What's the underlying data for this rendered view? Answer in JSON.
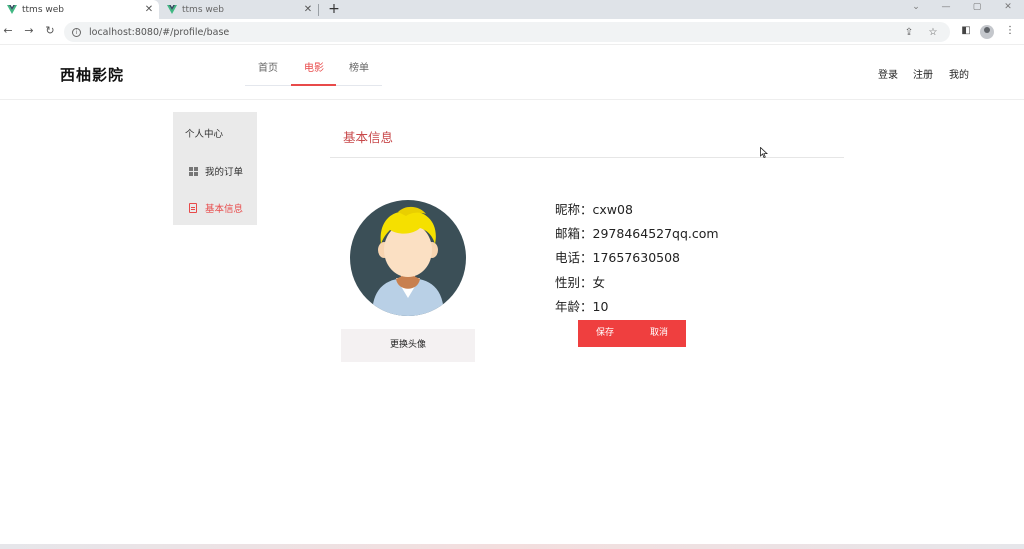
{
  "browser": {
    "tabs": [
      {
        "title": "ttms web",
        "active": true
      },
      {
        "title": "ttms web",
        "active": false
      }
    ],
    "url": "localhost:8080/#/profile/base",
    "icons": {
      "back": "back-arrow-icon",
      "forward": "forward-arrow-icon",
      "reload": "reload-icon",
      "share": "share-icon",
      "bookmark": "star-icon",
      "sidepanel": "side-panel-icon",
      "profile": "profile-icon",
      "menu": "kebab-menu-icon"
    }
  },
  "header": {
    "logo": "西柚影院",
    "nav": [
      "首页",
      "电影",
      "榜单"
    ],
    "active_nav": "电影",
    "auth": [
      "登录",
      "注册",
      "我的"
    ]
  },
  "sidebar": {
    "title": "个人中心",
    "items": [
      {
        "label": "我的订单",
        "icon": "grid-icon",
        "active": false
      },
      {
        "label": "基本信息",
        "icon": "document-icon",
        "active": true
      }
    ]
  },
  "profile": {
    "section_title": "基本信息",
    "change_avatar": "更换头像",
    "fields": [
      {
        "label": "昵称",
        "value": "cxw08"
      },
      {
        "label": "邮箱",
        "value": "2978464527qq.com"
      },
      {
        "label": "电话",
        "value": "17657630508"
      },
      {
        "label": "性别",
        "value": "女"
      },
      {
        "label": "年龄",
        "value": "10"
      }
    ],
    "separator": "：",
    "save": "保存",
    "cancel": "取消"
  },
  "colors": {
    "accent": "#e84a4a",
    "button": "#ef3f3f",
    "title": "#c8494b",
    "sidebar_bg": "#eaeaea"
  }
}
